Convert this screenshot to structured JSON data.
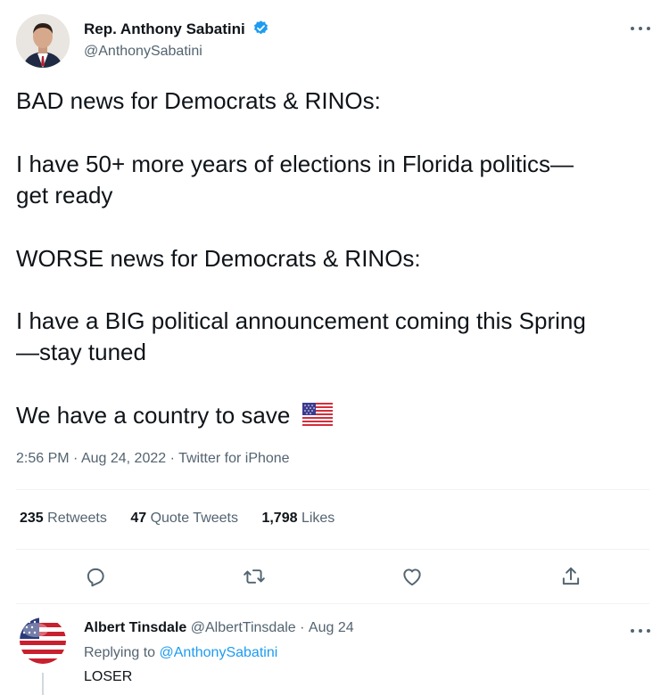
{
  "tweet": {
    "author_name": "Rep. Anthony Sabatini",
    "author_handle": "@AnthonySabatini",
    "lines": [
      "BAD news for Democrats & RINOs:",
      "I have 50+ more years of elections in Florida politics—",
      "get ready",
      "WORSE news for Democrats & RINOs:",
      "I have a BIG political announcement coming this Spring",
      "—stay tuned",
      "We have a country to save"
    ],
    "emoji": "us-flag-emoji",
    "time": "2:56 PM",
    "date": "Aug 24, 2022",
    "source": "Twitter for iPhone",
    "separator": "·"
  },
  "stats": {
    "retweets_count": "235",
    "retweets_label": "Retweets",
    "quotes_count": "47",
    "quotes_label": "Quote Tweets",
    "likes_count": "1,798",
    "likes_label": "Likes"
  },
  "actions": [
    "reply-icon",
    "retweet-icon",
    "like-icon",
    "share-icon"
  ],
  "reply": {
    "author_name": "Albert Tinsdale",
    "author_handle": "@AlbertTinsdale",
    "separator": "·",
    "date": "Aug 24",
    "replying_prefix": "Replying to",
    "replying_to": "@AnthonySabatini",
    "text": "LOSER"
  },
  "colors": {
    "text": "#0f1419",
    "secondary": "#536471",
    "accent": "#1d9bf0",
    "divider": "#eff3f4"
  }
}
